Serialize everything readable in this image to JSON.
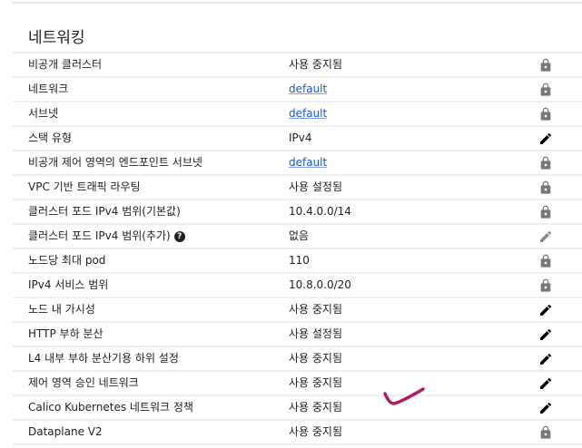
{
  "section_title": "네트워킹",
  "rows": [
    {
      "label": "비공개 클러스터",
      "value": "사용 중지됨",
      "link": false,
      "icon": "lock-icon"
    },
    {
      "label": "네트워크",
      "value": "default",
      "link": true,
      "icon": "lock-icon"
    },
    {
      "label": "서브넷",
      "value": "default",
      "link": true,
      "icon": "lock-icon"
    },
    {
      "label": "스택 유형",
      "value": "IPv4",
      "link": false,
      "icon": "edit-icon"
    },
    {
      "label": "비공개 제어 영역의 엔드포인트 서브넷",
      "value": "default",
      "link": true,
      "icon": "lock-icon"
    },
    {
      "label": "VPC 기반 트래픽 라우팅",
      "value": "사용 설정됨",
      "link": false,
      "icon": "lock-icon"
    },
    {
      "label": "클러스터 포드 IPv4 범위(기본값)",
      "value": "10.4.0.0/14",
      "link": false,
      "icon": "lock-icon"
    },
    {
      "label": "클러스터 포드 IPv4 범위(추가)",
      "value": "없음",
      "link": false,
      "icon": "edit-disabled-icon",
      "help": "?"
    },
    {
      "label": "노드당 최대 pod",
      "value": "110",
      "link": false,
      "icon": "lock-icon"
    },
    {
      "label": "IPv4 서비스 범위",
      "value": "10.8.0.0/20",
      "link": false,
      "icon": "lock-icon"
    },
    {
      "label": "노드 내 가시성",
      "value": "사용 중지됨",
      "link": false,
      "icon": "edit-icon"
    },
    {
      "label": "HTTP 부하 분산",
      "value": "사용 설정됨",
      "link": false,
      "icon": "edit-icon"
    },
    {
      "label": "L4 내부 부하 분산기용 하위 설정",
      "value": "사용 중지됨",
      "link": false,
      "icon": "edit-icon"
    },
    {
      "label": "제어 영역 승인 네트워크",
      "value": "사용 중지됨",
      "link": false,
      "icon": "edit-icon"
    },
    {
      "label": "Calico Kubernetes 네트워크 정책",
      "value": "사용 중지됨",
      "link": false,
      "icon": "edit-icon"
    },
    {
      "label": "Dataplane V2",
      "value": "사용 중지됨",
      "link": false,
      "icon": "lock-icon"
    }
  ],
  "colors": {
    "link": "#1a55d6",
    "lock": "#777777",
    "edit": "#000000",
    "edit_disabled": "#888888",
    "annotation": "#b5195f"
  }
}
